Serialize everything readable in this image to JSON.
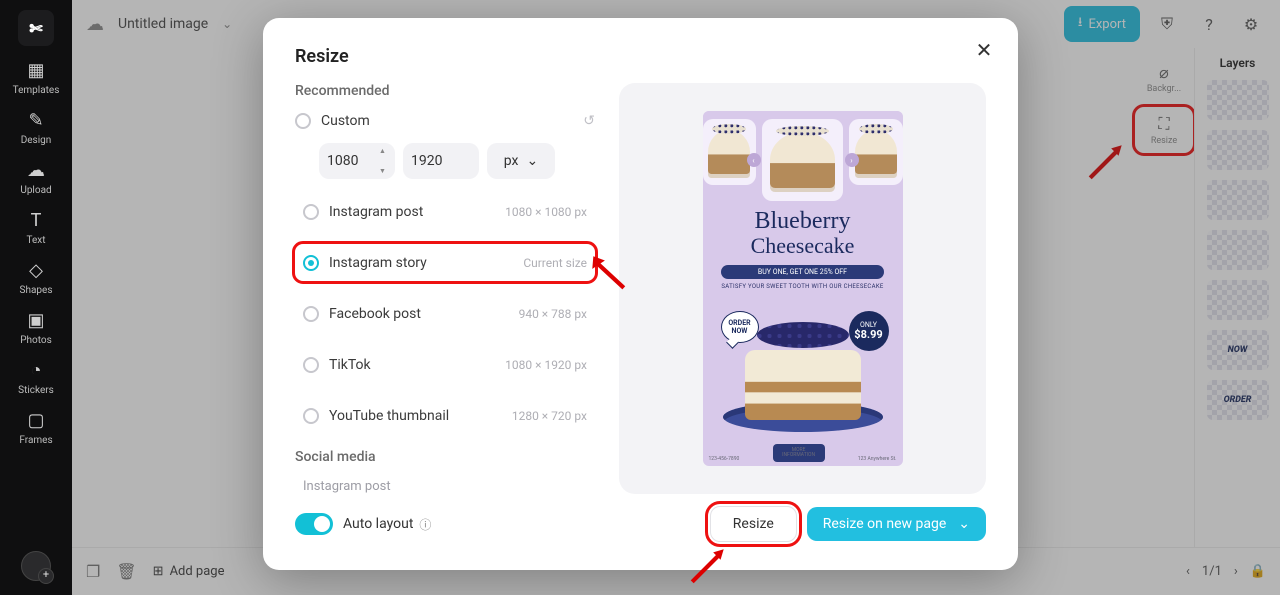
{
  "topbar": {
    "title": "Untitled image",
    "export_label": "Export"
  },
  "sidebar": {
    "items": [
      {
        "label": "Templates"
      },
      {
        "label": "Design"
      },
      {
        "label": "Upload"
      },
      {
        "label": "Text"
      },
      {
        "label": "Shapes"
      },
      {
        "label": "Photos"
      },
      {
        "label": "Stickers"
      },
      {
        "label": "Frames"
      }
    ]
  },
  "right_tools": [
    {
      "label": "Backgr..."
    },
    {
      "label": "Resize"
    }
  ],
  "layers": {
    "title": "Layers",
    "items": [
      "",
      "",
      "",
      "",
      "",
      "NOW",
      "ORDER"
    ]
  },
  "bottom": {
    "add_page": "Add page",
    "page_indicator": "1/1"
  },
  "modal": {
    "title": "Resize",
    "recommended_label": "Recommended",
    "custom_label": "Custom",
    "width_value": "1080",
    "height_value": "1920",
    "unit_value": "px",
    "options": [
      {
        "label": "Instagram post",
        "meta": "1080 × 1080 px",
        "selected": false
      },
      {
        "label": "Instagram story",
        "meta": "Current size",
        "selected": true
      },
      {
        "label": "Facebook post",
        "meta": "940 × 788 px",
        "selected": false
      },
      {
        "label": "TikTok",
        "meta": "1080 × 1920 px",
        "selected": false
      },
      {
        "label": "YouTube thumbnail",
        "meta": "1280 × 720 px",
        "selected": false
      }
    ],
    "social_label": "Social media",
    "social_item": "Instagram post",
    "auto_layout_label": "Auto layout",
    "resize_btn": "Resize",
    "resize_new_btn": "Resize on new page"
  },
  "poster": {
    "title1": "Blueberry",
    "title2": "Cheesecake",
    "pill": "BUY ONE, GET ONE 25% OFF",
    "sub": "SATISFY YOUR SWEET TOOTH WITH OUR CHEESECAKE",
    "bubble": "ORDER NOW",
    "badge_top": "ONLY",
    "badge_price": "$8.99",
    "more1": "MORE",
    "more2": "INFORMATION",
    "foot_left": "123-456-7890",
    "foot_right": "123 Anywhere St."
  }
}
